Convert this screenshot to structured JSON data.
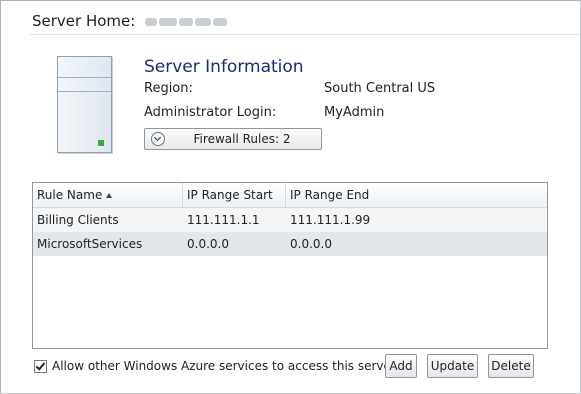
{
  "header": {
    "label": "Server Home:"
  },
  "server_info": {
    "title": "Server Information",
    "region_label": "Region:",
    "region_value": "South Central US",
    "admin_label": "Administrator Login:",
    "admin_value": "MyAdmin",
    "firewall_button": "Firewall Rules: 2",
    "icons": {
      "server": "server-icon",
      "expand": "chevron-down-icon"
    }
  },
  "rules_table": {
    "columns": [
      "Rule Name",
      "IP Range Start",
      "IP Range End"
    ],
    "sort_column": "Rule Name",
    "rows": [
      {
        "name": "Billing Clients",
        "start": "111.111.1.1",
        "end": "111.111.1.99"
      },
      {
        "name": "MicrosoftServices",
        "start": "0.0.0.0",
        "end": "0.0.0.0"
      }
    ]
  },
  "footer": {
    "allow_azure_label": "Allow other Windows Azure services to access this server",
    "allow_azure_checked": true,
    "add_label": "Add",
    "update_label": "Update",
    "delete_label": "Delete"
  },
  "colors": {
    "title_blue": "#1c2b78",
    "status_led": "#3faa3a"
  }
}
